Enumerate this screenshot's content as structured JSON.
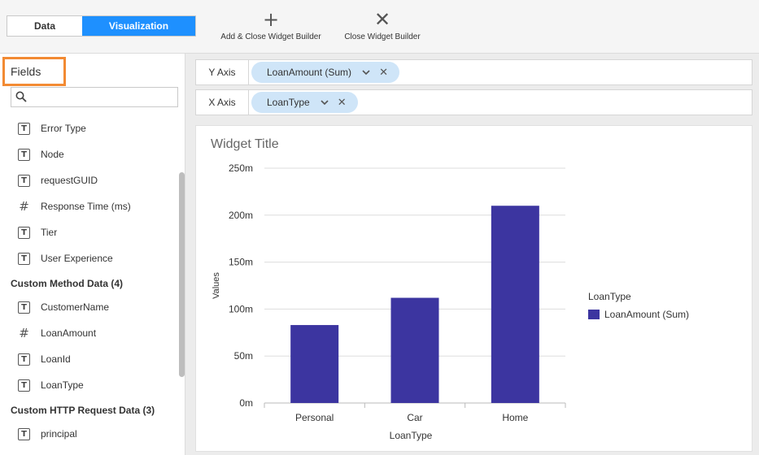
{
  "tabs": {
    "data": "Data",
    "visualization": "Visualization"
  },
  "toolbar": {
    "add_close": "Add & Close Widget Builder",
    "close": "Close Widget Builder"
  },
  "fields_panel": {
    "title": "Fields",
    "search_placeholder": "",
    "top_items": [
      {
        "label": "Error Type",
        "icon": "text-type-icon"
      },
      {
        "label": "Node",
        "icon": "text-type-icon"
      },
      {
        "label": "requestGUID",
        "icon": "text-type-icon"
      },
      {
        "label": "Response Time (ms)",
        "icon": "number-type-icon"
      },
      {
        "label": "Tier",
        "icon": "text-type-icon"
      },
      {
        "label": "User Experience",
        "icon": "text-type-icon"
      }
    ],
    "custom_method_header": "Custom Method Data (4)",
    "custom_method_items": [
      {
        "label": "CustomerName",
        "icon": "text-type-icon"
      },
      {
        "label": "LoanAmount",
        "icon": "number-type-icon"
      },
      {
        "label": "LoanId",
        "icon": "text-type-icon"
      },
      {
        "label": "LoanType",
        "icon": "text-type-icon"
      }
    ],
    "custom_http_header": "Custom HTTP Request Data (3)",
    "custom_http_items": [
      {
        "label": "principal",
        "icon": "text-type-icon"
      }
    ]
  },
  "y_axis": {
    "label": "Y Axis",
    "chip": "LoanAmount (Sum)"
  },
  "x_axis": {
    "label": "X Axis",
    "chip": "LoanType"
  },
  "widget": {
    "title": "Widget Title"
  },
  "colors": {
    "accent": "#1e90ff",
    "bar": "#3c35a0",
    "chip": "#cfe5f8",
    "highlight": "#f28a33"
  },
  "chart_data": {
    "type": "bar",
    "categories": [
      "Personal",
      "Car",
      "Home"
    ],
    "values": [
      83,
      112,
      210
    ],
    "series": [
      {
        "name": "LoanAmount (Sum)",
        "values": [
          83,
          112,
          210
        ]
      }
    ],
    "unit_suffix": "m",
    "ylim": [
      0,
      250
    ],
    "yticks": [
      0,
      50,
      100,
      150,
      200,
      250
    ],
    "ytick_labels": [
      "0m",
      "50m",
      "100m",
      "150m",
      "200m",
      "250m"
    ],
    "xlabel": "LoanType",
    "ylabel": "Values",
    "legend_title": "LoanType",
    "legend_placement": "right",
    "grid": true
  }
}
